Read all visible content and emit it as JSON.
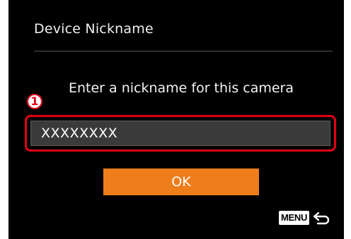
{
  "screen": {
    "title": "Device Nickname",
    "prompt": "Enter a nickname for this camera",
    "nickname_field": {
      "value": "XXXXXXXX"
    },
    "ok_label": "OK",
    "menu_key_label": "MENU",
    "return_icon": "return-arrow-icon"
  },
  "callout": {
    "number": "1",
    "color": "#e00012"
  },
  "colors": {
    "background": "#000000",
    "ok_button": "#ee7d1b",
    "field_background": "#3a3a3a"
  }
}
